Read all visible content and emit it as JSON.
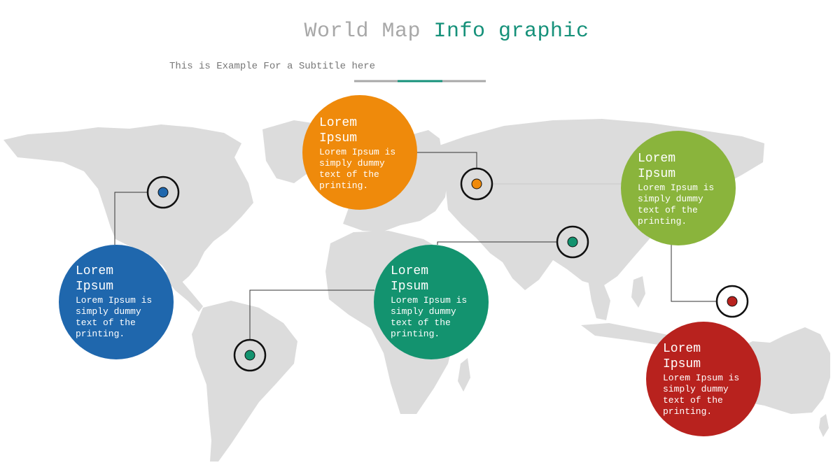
{
  "header": {
    "title_part1": "World Map",
    "title_part2": "Info graphic",
    "subtitle": "This is Example For a Subtitle here"
  },
  "colors": {
    "blue": "#1f67ad",
    "orange": "#ef8a0b",
    "green": "#8ab43c",
    "teal": "#13936f",
    "red": "#b8221e",
    "map": "#dcdcdc",
    "divider_gray": "#a8a8a8",
    "divider_accent": "#16917a"
  },
  "bubbles": [
    {
      "id": "blue",
      "title": "Lorem\nIpsum",
      "body": "Lorem Ipsum is\nsimply dummy\ntext of the\nprinting."
    },
    {
      "id": "orange",
      "title": "Lorem\nIpsum",
      "body": "Lorem Ipsum is\nsimply dummy\ntext of the\nprinting."
    },
    {
      "id": "green",
      "title": "Lorem\nIpsum",
      "body": "Lorem Ipsum is\nsimply dummy\ntext of the\nprinting."
    },
    {
      "id": "teal",
      "title": "Lorem\nIpsum",
      "body": "Lorem Ipsum is\nsimply dummy\ntext of the\nprinting."
    },
    {
      "id": "red",
      "title": "Lorem\nIpsum",
      "body": "Lorem Ipsum is\nsimply dummy\ntext of the\nprinting."
    }
  ],
  "markers": [
    {
      "name": "north-america-marker",
      "color": "blue"
    },
    {
      "name": "europe-marker",
      "color": "orange"
    },
    {
      "name": "asia-marker",
      "color": "teal"
    },
    {
      "name": "southeast-asia-marker",
      "color": "red"
    },
    {
      "name": "south-america-marker",
      "color": "teal"
    }
  ]
}
